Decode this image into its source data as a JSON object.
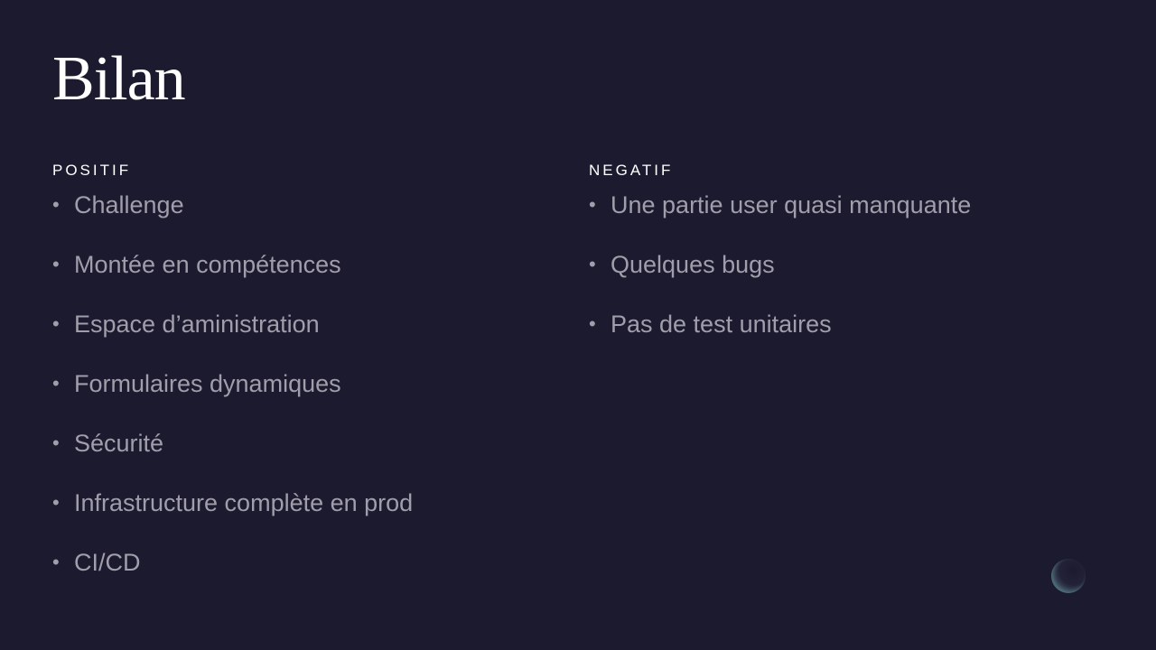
{
  "slide": {
    "title": "Bilan",
    "positive": {
      "heading": "POSITIF",
      "items": [
        "Challenge",
        "Montée en compétences",
        "Espace d’aministration",
        "Formulaires dynamiques",
        "Sécurité",
        "Infrastructure complète en prod",
        "CI/CD"
      ]
    },
    "negative": {
      "heading": "NEGATIF",
      "items": [
        "Une partie user quasi manquante",
        "Quelques bugs",
        "Pas de test unitaires"
      ]
    },
    "bullet": "•"
  },
  "colors": {
    "background": "#1c1a2e",
    "heading": "#ffffff",
    "item": "#a09eab"
  }
}
